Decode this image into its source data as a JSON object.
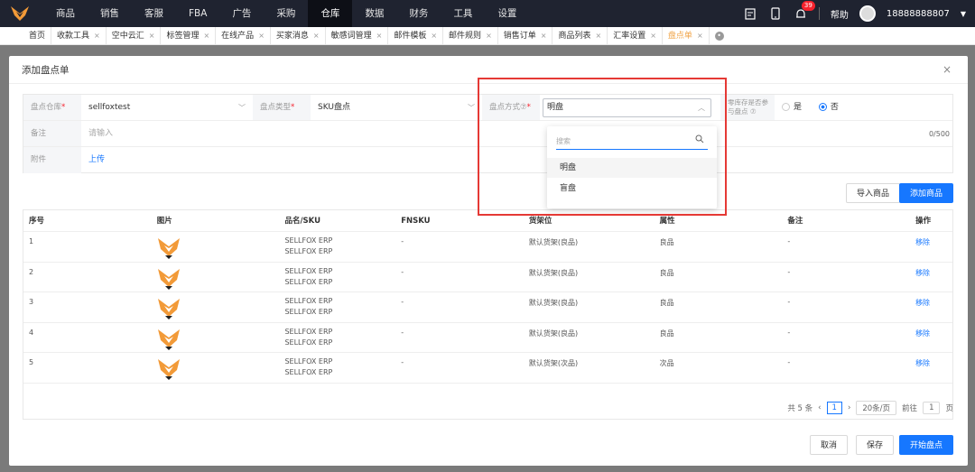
{
  "topnav": {
    "items": [
      "商品",
      "销售",
      "客服",
      "FBA",
      "广告",
      "采购",
      "仓库",
      "数据",
      "财务",
      "工具",
      "设置"
    ],
    "active_index": 6,
    "notification_count": "39",
    "help": "帮助",
    "phone": "18888888807"
  },
  "tabs": {
    "items": [
      "首页",
      "收款工具",
      "空中云汇",
      "标签管理",
      "在线产品",
      "买家消息",
      "敏感词管理",
      "邮件模板",
      "邮件规则",
      "销售订单",
      "商品列表",
      "汇率设置",
      "盘点单"
    ],
    "active_index": 12
  },
  "modal": {
    "title": "添加盘点单",
    "close": "×"
  },
  "form": {
    "warehouse_label": "盘点仓库",
    "warehouse_value": "sellfoxtest",
    "type_label": "盘点类型",
    "type_value": "SKU盘点",
    "method_label": "盘点方式⑦",
    "method_value": "明盘",
    "include_label": "零库存是否参与盘点 ⑦",
    "yes": "是",
    "no": "否",
    "remark_label": "备注",
    "remark_placeholder": "请输入",
    "remark_count": "0/500",
    "attach_label": "附件",
    "upload": "上传"
  },
  "dropdown": {
    "search_placeholder": "搜索",
    "options": [
      "明盘",
      "盲盘"
    ]
  },
  "actions": {
    "import": "导入商品",
    "add": "添加商品",
    "cancel": "取消",
    "save": "保存",
    "start": "开始盘点"
  },
  "table": {
    "headers": [
      "序号",
      "图片",
      "品名/SKU",
      "FNSKU",
      "货架位",
      "属性",
      "备注",
      "操作"
    ],
    "rows": [
      {
        "no": "1",
        "name": "SELLFOX ERP",
        "sku": "SELLFOX ERP",
        "fnsku": "-",
        "shelf": "默认货架(良品)",
        "attr": "良品",
        "remark": "-",
        "op": "移除"
      },
      {
        "no": "2",
        "name": "SELLFOX ERP",
        "sku": "SELLFOX ERP",
        "fnsku": "-",
        "shelf": "默认货架(良品)",
        "attr": "良品",
        "remark": "-",
        "op": "移除"
      },
      {
        "no": "3",
        "name": "SELLFOX ERP",
        "sku": "SELLFOX ERP",
        "fnsku": "-",
        "shelf": "默认货架(良品)",
        "attr": "良品",
        "remark": "-",
        "op": "移除"
      },
      {
        "no": "4",
        "name": "SELLFOX ERP",
        "sku": "SELLFOX ERP",
        "fnsku": "-",
        "shelf": "默认货架(良品)",
        "attr": "良品",
        "remark": "-",
        "op": "移除"
      },
      {
        "no": "5",
        "name": "SELLFOX ERP",
        "sku": "SELLFOX ERP",
        "fnsku": "-",
        "shelf": "默认货架(次品)",
        "attr": "次品",
        "remark": "-",
        "op": "移除"
      }
    ]
  },
  "pager": {
    "total": "共 5 条",
    "page": "1",
    "page_size": "20条/页",
    "goto": "前往",
    "goto_value": "1",
    "unit": "页"
  }
}
